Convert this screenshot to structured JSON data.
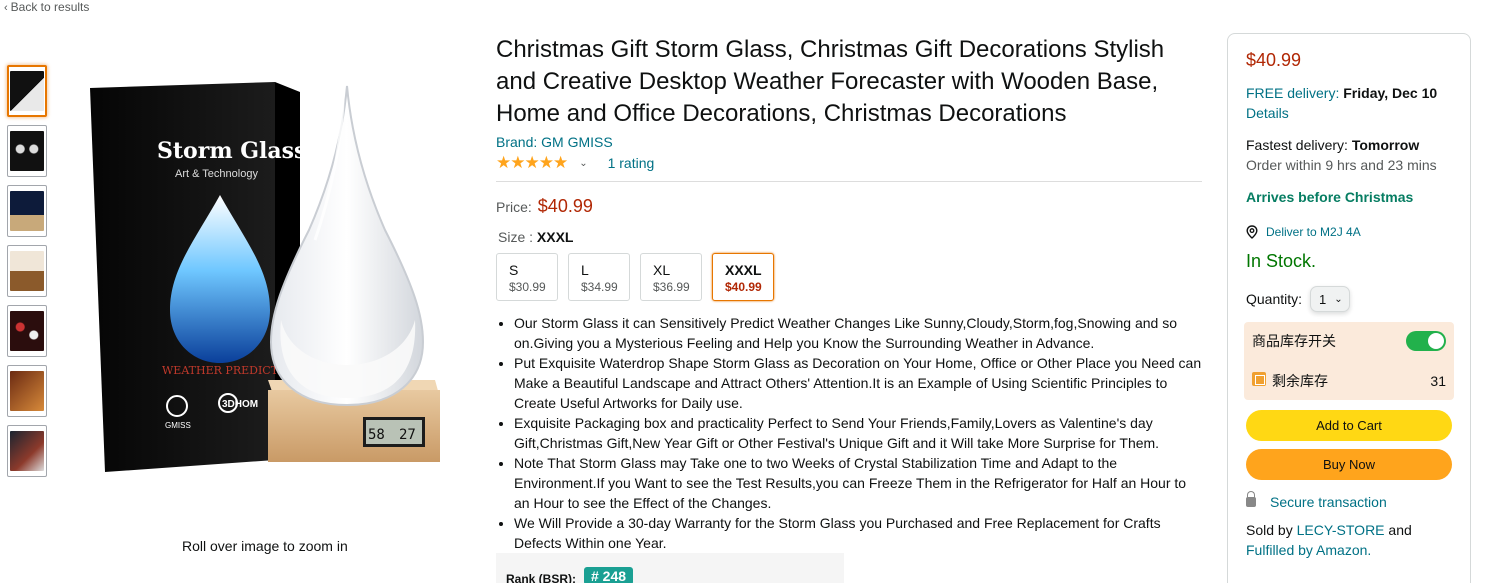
{
  "nav": {
    "back_label": "Back to results"
  },
  "gallery": {
    "zoom_hint": "Roll over image to zoom in",
    "box_title": "Storm Glass",
    "box_subtitle": "Art & Technology",
    "box_tagline": "WEATHER  PREDICTOP",
    "logo_left": "GMISS",
    "logo_right": "3DHOM",
    "thermo_humidity": "58",
    "thermo_temp": "27",
    "thumb_count": 7
  },
  "product": {
    "title": "Christmas Gift Storm Glass, Christmas Gift Decorations Stylish and Creative Desktop Weather Forecaster with Wooden Base, Home and Office Decorations, Christmas Decorations",
    "brand": "Brand: GM GMISS",
    "stars": "★★★★★",
    "rating_value": 5,
    "rating_count": "1 rating",
    "price_label": "Price:",
    "price": "$40.99",
    "size_label": "Size :",
    "size_selected": "XXXL",
    "sizes": [
      {
        "name": "S",
        "price": "$30.99"
      },
      {
        "name": "L",
        "price": "$34.99"
      },
      {
        "name": "XL",
        "price": "$36.99"
      },
      {
        "name": "XXXL",
        "price": "$40.99"
      }
    ],
    "bullets": [
      "Our Storm Glass it can Sensitively Predict Weather Changes Like Sunny,Cloudy,Storm,fog,Snowing and so on.Giving you a Mysterious Feeling and Help you Know the Surrounding Weather in Advance.",
      "Put Exquisite Waterdrop Shape Storm Glass as Decoration on Your Home, Office or Other Place you Need can Make a Beautiful Landscape and Attract Others' Attention.It is an Example of Using Scientific Principles to Create Useful Artworks for Daily use.",
      "Exquisite Packaging box and practicality Perfect to Send Your Friends,Family,Lovers as Valentine's day Gift,Christmas Gift,New Year Gift or Other Festival's Unique Gift and it Will take More Surprise for Them.",
      "Note That Storm Glass may Take one to two Weeks of Crystal Stabilization Time and Adapt to the Environment.If you Want to see the Test Results,you can Freeze Them in the Refrigerator for Half an Hour to an Hour to see the Effect of the Changes.",
      "We Will Provide a 30-day Warranty for the Storm Glass you Purchased and Free Replacement for Crafts Defects Within one Year."
    ],
    "rank_label": "Rank (BSR):",
    "rank_value": "# 248"
  },
  "buybox": {
    "price": "$40.99",
    "free_delivery_label": "FREE delivery:",
    "free_delivery_date": "Friday, Dec 10",
    "details_link": "Details",
    "fastest_label": "Fastest delivery:",
    "fastest_date": "Tomorrow",
    "order_within": "Order within 9 hrs and 23 mins",
    "arrives_before": "Arrives before Christmas",
    "deliver_to": "Deliver to  M2J 4A",
    "stock": "In Stock.",
    "quantity_label": "Quantity:",
    "quantity_value": "1",
    "inventory_toggle_label": "商品库存开关",
    "inventory_toggle_on": true,
    "remaining_label": "剩余库存",
    "remaining_value": "31",
    "add_to_cart": "Add to Cart",
    "buy_now": "Buy Now",
    "secure": "Secure transaction",
    "sold_by_prefix": "Sold by",
    "seller": "LECY-STORE",
    "sold_by_and": "and",
    "fulfilled_by": "Fulfilled by Amazon."
  },
  "colors": {
    "price": "#b12704",
    "link": "#007185",
    "cart_button": "#ffd814",
    "buy_button": "#ffa41c",
    "in_stock": "#007600",
    "toggle_on": "#22b14c",
    "rank_badge": "#1aa093"
  }
}
